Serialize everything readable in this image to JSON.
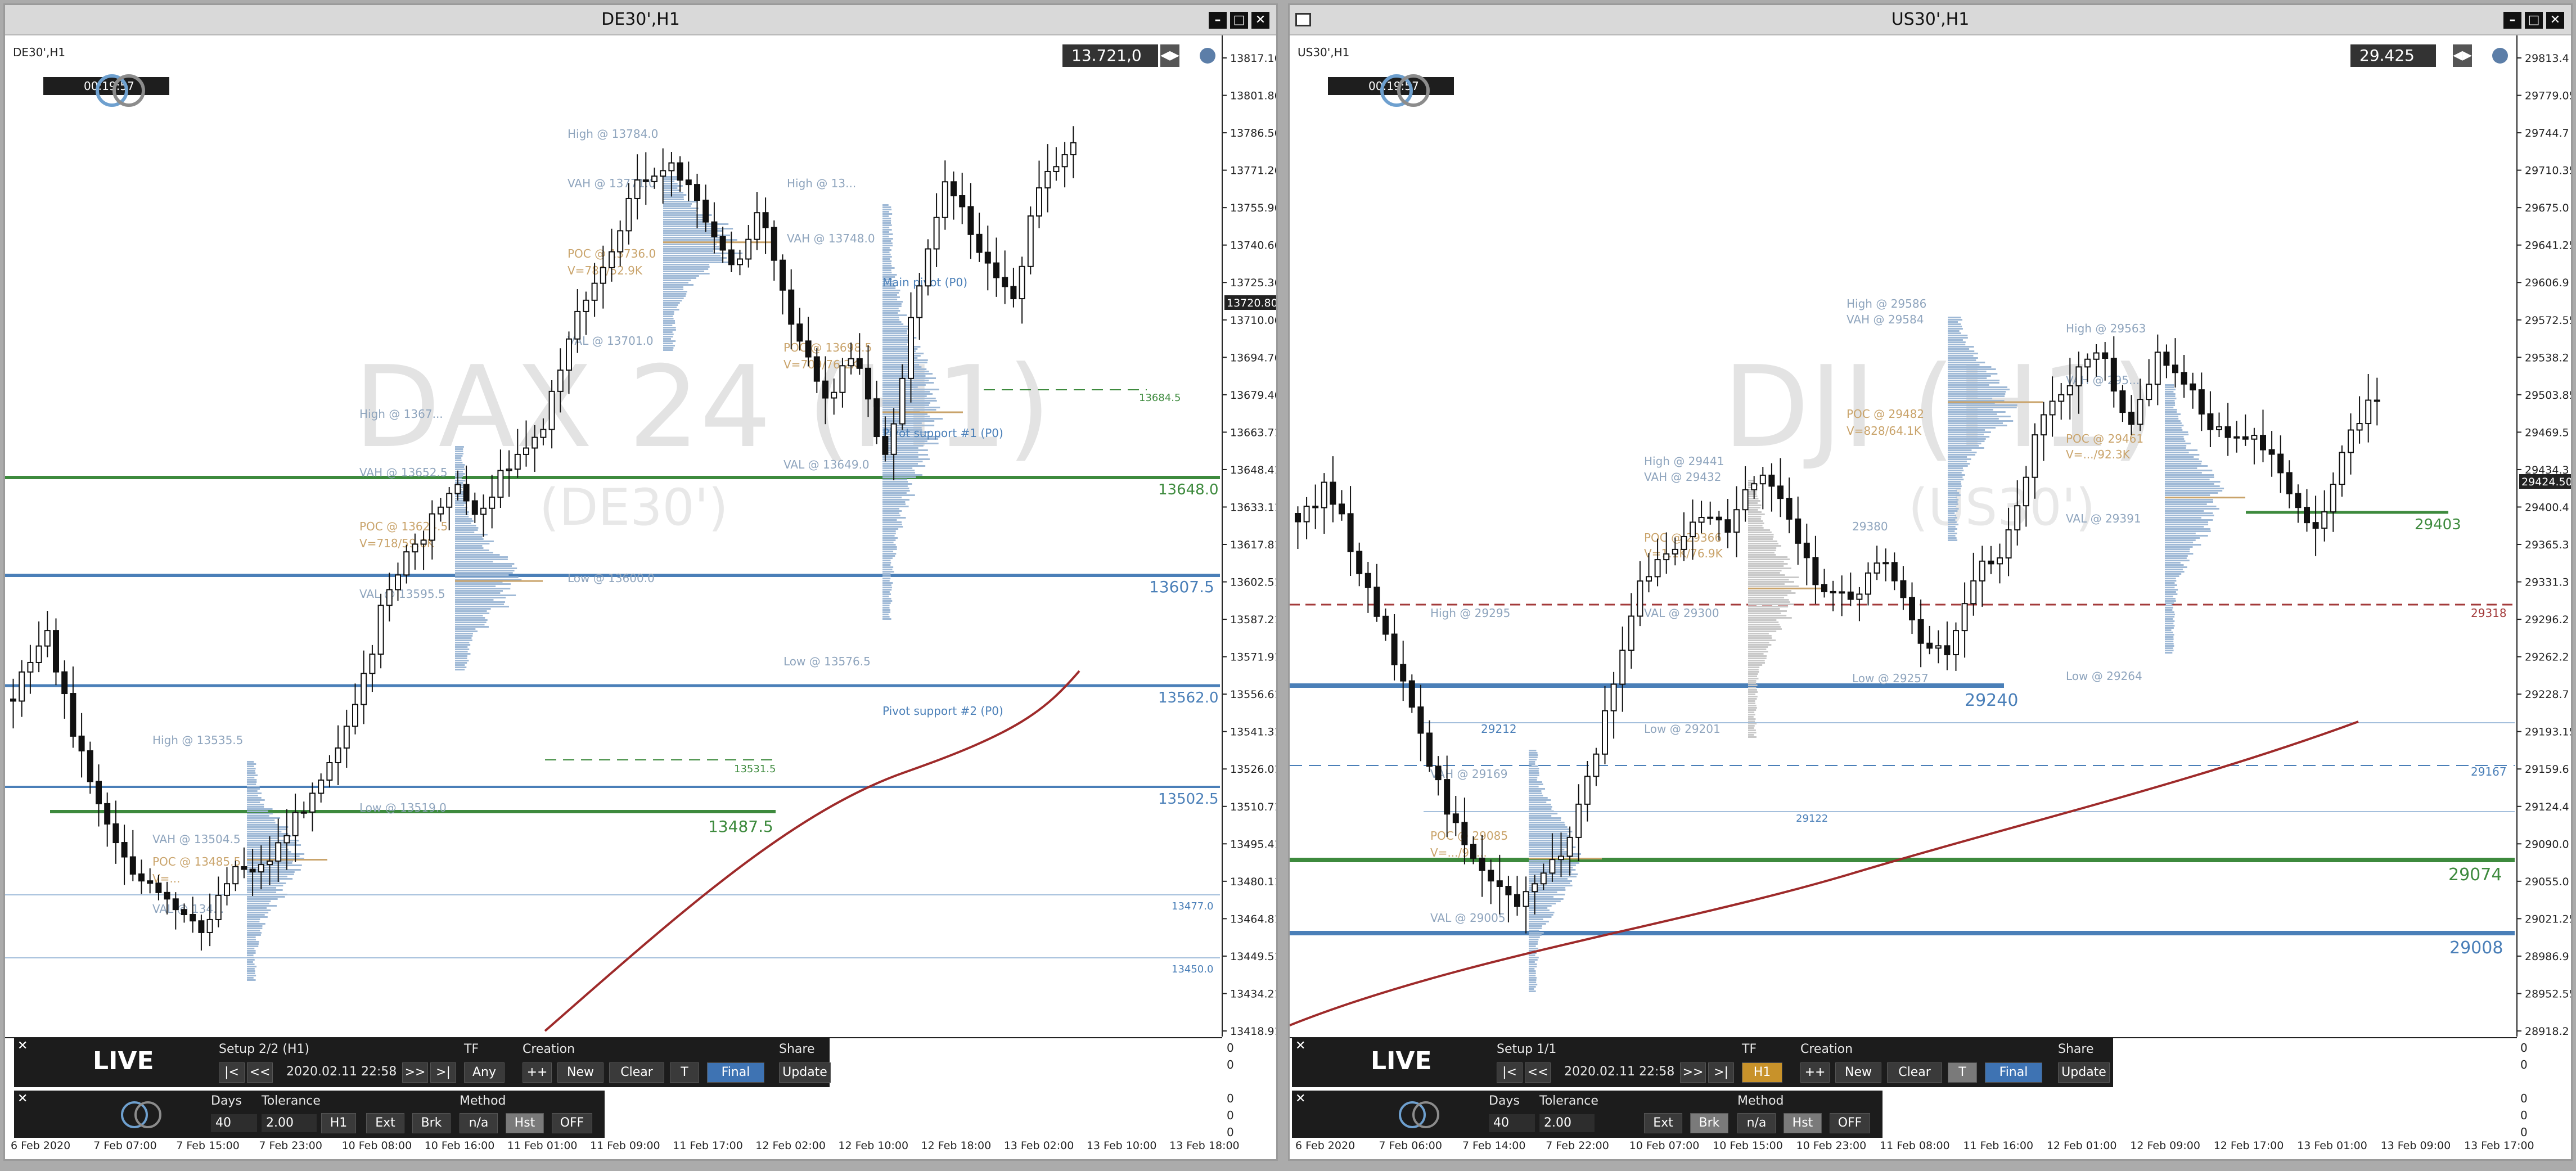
{
  "windows": [
    {
      "title": "DE30',H1",
      "symbol_label": "DE30',H1",
      "price_box": "13.721,0",
      "timer": "00:19:57",
      "watermark": "DAX 24 (H1)",
      "watermark_sub": "(DE30')",
      "y_axis": [
        "13817.16",
        "13801.86",
        "13786.56",
        "13771.26",
        "13755.96",
        "13740.66",
        "13725.36",
        "13710.06",
        "13694.76",
        "13679.46",
        "13663.71",
        "13648.41",
        "13633.11",
        "13617.81",
        "13602.51",
        "13587.21",
        "13571.91",
        "13556.61",
        "13541.31",
        "13526.01",
        "13510.71",
        "13495.41",
        "13480.11",
        "13464.81",
        "13449.51",
        "13434.21",
        "13418.91"
      ],
      "current_price_tag": "13720.80",
      "x_axis": [
        "6 Feb 2020",
        "7 Feb 07:00",
        "7 Feb 15:00",
        "7 Feb 23:00",
        "10 Feb 08:00",
        "10 Feb 16:00",
        "11 Feb 01:00",
        "11 Feb 09:00",
        "11 Feb 17:00",
        "12 Feb 02:00",
        "12 Feb 10:00",
        "12 Feb 18:00",
        "13 Feb 02:00",
        "13 Feb 10:00",
        "13 Feb 18:00"
      ],
      "levels": [
        {
          "label": "13648.0",
          "color": "#3d8a3d"
        },
        {
          "label": "13607.5",
          "color": "#4a7fb8"
        },
        {
          "label": "13562.0",
          "color": "#4a7fb8"
        },
        {
          "label": "13502.5",
          "color": "#4a7fb8"
        },
        {
          "label": "13487.5",
          "color": "#3d8a3d"
        },
        {
          "label": "13684.5",
          "color": "#3d8a3d"
        },
        {
          "label": "13531.5",
          "color": "#3d8a3d"
        },
        {
          "label": "13477.0",
          "color": "#4a7fb8"
        },
        {
          "label": "13450.0",
          "color": "#4a7fb8"
        }
      ],
      "profile_labels": [
        "High @ 13784.0",
        "VAH @ 13771.0",
        "POC @ 13736.0",
        "V=788/52.9K",
        "VAL @ 13701.0",
        "High @ 13...",
        "VAH @ 13748.0",
        "POC @ 13698.5",
        "V=709/76.2K",
        "VAL @ 13649.0",
        "Low @ 13576.5",
        "High @ 1367...",
        "VAH @ 13652.5",
        "POC @ 13624.5",
        "V=718/59.6K",
        "VAL @ 13595.5",
        "Low @ 13600.0",
        "High @ 13535.5",
        "Low @ 13519.0",
        "VAH @ 13504.5",
        "POC @ 13485.5",
        "V=...",
        "VAL @ 134...",
        "Main pivot (P0)",
        "Pivot support #1 (P0)",
        "Pivot support #2 (P0)"
      ],
      "panel1": {
        "setup": "Setup 2/2 (H1)",
        "tf_label": "TF",
        "creation_label": "Creation",
        "share_label": "Share",
        "date": "2020.02.11 22:58",
        "tf_value": "Any",
        "btns": [
          "|<",
          "<<",
          ">>",
          ">|",
          "++",
          "New",
          "Clear",
          "T",
          "Final",
          "Update"
        ]
      },
      "panel2": {
        "days_label": "Days",
        "tol_label": "Tolerance",
        "method_label": "Method",
        "days": "40",
        "tol": "2.00",
        "btns": [
          "H1",
          "Ext",
          "Brk",
          "n/a",
          "Hst",
          "OFF"
        ]
      },
      "live_label": "LIVE",
      "side_axis": [
        "0",
        "0",
        "0",
        "0",
        "0"
      ]
    },
    {
      "title": "US30',H1",
      "symbol_label": "US30',H1",
      "price_box": "29.425",
      "timer": "00:19:57",
      "watermark": "DJI (H1)",
      "watermark_sub": "(US30')",
      "y_axis": [
        "29813.4",
        "29779.05",
        "29744.7",
        "29710.35",
        "29675.0",
        "29641.25",
        "29606.9",
        "29572.55",
        "29538.2",
        "29503.85",
        "29469.5",
        "29434.3",
        "29400.4",
        "29365.3",
        "29331.3",
        "29296.2",
        "29262.2",
        "29228.7",
        "29193.15",
        "29159.6",
        "29124.4",
        "29090.0",
        "29055.0",
        "29021.25",
        "28986.9",
        "28952.55",
        "28918.2"
      ],
      "current_price_tag": "29424.50",
      "x_axis": [
        "6 Feb 2020",
        "7 Feb 06:00",
        "7 Feb 14:00",
        "7 Feb 22:00",
        "10 Feb 07:00",
        "10 Feb 15:00",
        "10 Feb 23:00",
        "11 Feb 08:00",
        "11 Feb 16:00",
        "12 Feb 01:00",
        "12 Feb 09:00",
        "12 Feb 17:00",
        "13 Feb 01:00",
        "13 Feb 09:00",
        "13 Feb 17:00"
      ],
      "levels": [
        {
          "label": "29403",
          "color": "#3d8a3d"
        },
        {
          "label": "29318",
          "color": "#a33a3a"
        },
        {
          "label": "29240",
          "color": "#4a7fb8"
        },
        {
          "label": "29167",
          "color": "#4a7fb8"
        },
        {
          "label": "29122",
          "color": "#4a7fb8"
        },
        {
          "label": "29212",
          "color": "#4a7fb8"
        },
        {
          "label": "29074",
          "color": "#3d8a3d"
        },
        {
          "label": "29008",
          "color": "#4a7fb8"
        }
      ],
      "profile_labels": [
        "High @ 29586",
        "VAH @ 29584",
        "POC @ 29482",
        "V=828/64.1K",
        "High @ 29563",
        "VAH @ 295...",
        "POC @ 29461",
        "V=.../92.3K",
        "VAL @ 29391",
        "Low @ 29264",
        "High @ 29441",
        "VAH @ 29432",
        "POC @ 29366",
        "V=1.1K/76.9K",
        "VAL @ 29300",
        "Low @ 29257",
        "29380",
        "High @ 29295",
        "Low @ 29201",
        "VAH @ 29169",
        "POC @ 29085",
        "V=.../97...",
        "VAL @ 29005"
      ],
      "panel1": {
        "setup": "Setup 1/1",
        "tf_label": "TF",
        "creation_label": "Creation",
        "share_label": "Share",
        "date": "2020.02.11 22:58",
        "tf_value": "H1",
        "btns": [
          "|<",
          "<<",
          ">>",
          ">|",
          "++",
          "New",
          "Clear",
          "T",
          "Final",
          "Update"
        ]
      },
      "panel2": {
        "days_label": "Days",
        "tol_label": "Tolerance",
        "method_label": "Method",
        "days": "40",
        "tol": "2.00",
        "btns": [
          "Ext",
          "Brk",
          "n/a",
          "Hst",
          "OFF"
        ]
      },
      "live_label": "LIVE",
      "side_axis": [
        "0",
        "0",
        "0",
        "0",
        "0"
      ]
    }
  ],
  "colors": {
    "green": "#3d8a3d",
    "blue": "#4a7fb8",
    "red": "#a33a3a",
    "ma": "#9e2a2a",
    "poc": "#c9a36a",
    "profile": "#9fb9d6",
    "label": "#8ea4bd"
  }
}
